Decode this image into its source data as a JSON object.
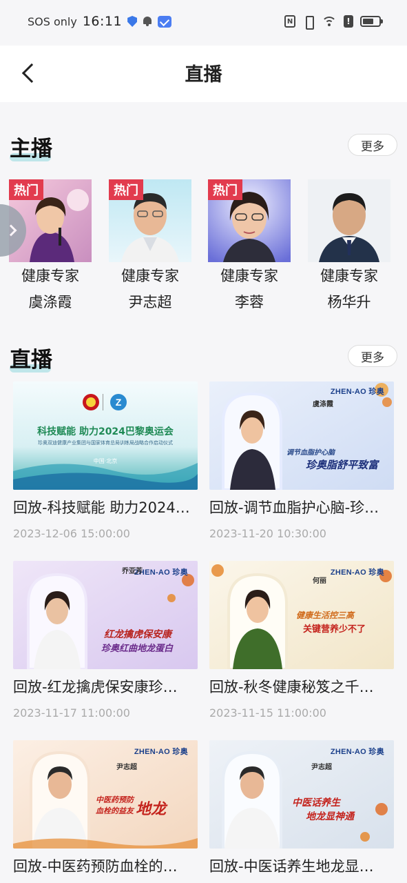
{
  "status_bar": {
    "carrier": "SOS only",
    "time": "16:11",
    "icons": [
      "shield-icon",
      "bell-icon",
      "mail-icon",
      "nfc-icon",
      "vibrate-icon",
      "wifi-icon",
      "alert-icon",
      "battery-icon"
    ]
  },
  "header": {
    "title": "直播",
    "back_icon": "chevron-left-icon"
  },
  "anchors_section": {
    "title": "主播",
    "more_label": "更多",
    "hot_label": "热门",
    "items": [
      {
        "role": "健康专家",
        "name": "虞涤霞",
        "hot": true
      },
      {
        "role": "健康专家",
        "name": "尹志超",
        "hot": true
      },
      {
        "role": "健康专家",
        "name": "李蓉",
        "hot": true
      },
      {
        "role": "健康专家",
        "name": "杨华升",
        "hot": false
      }
    ]
  },
  "live_section": {
    "title": "直播",
    "more_label": "更多",
    "items": [
      {
        "title": "回放-科技赋能 助力2024…",
        "time": "2023-12-06 15:00:00",
        "thumb": {
          "headline": "科技赋能 助力2024巴黎奥运会",
          "subline": "珍奥双迪健康产业集团与国家体育总局训练局战略合作启动仪式",
          "place": "中国·北京"
        }
      },
      {
        "title": "回放-调节血脂护心脑-珍…",
        "time": "2023-11-20 10:30:00",
        "thumb": {
          "brand": "ZHEN-AO 珍奥",
          "person": "虞涤霞",
          "line1": "调节血脂护心脑",
          "line2": "珍奥脂舒平致富"
        }
      },
      {
        "title": "回放-红龙擒虎保安康珍…",
        "time": "2023-11-17 11:00:00",
        "thumb": {
          "brand": "ZHEN-AO 珍奥",
          "person": "乔亚芳",
          "line1": "红龙擒虎保安康",
          "line2": "珍奥红曲地龙蛋白"
        }
      },
      {
        "title": "回放-秋冬健康秘笈之千…",
        "time": "2023-11-15 11:00:00",
        "thumb": {
          "brand": "ZHEN-AO 珍奥",
          "person": "何丽",
          "line1": "健康生活控三高",
          "line2": "关键营养少不了"
        }
      },
      {
        "title": "回放-中医药预防血栓的…",
        "time": "",
        "thumb": {
          "brand": "ZHEN-AO 珍奥",
          "person": "尹志超",
          "line1": "中医药预防",
          "line2": "血栓的益友",
          "line3": "地龙"
        }
      },
      {
        "title": "回放-中医话养生地龙显…",
        "time": "",
        "thumb": {
          "brand": "ZHEN-AO 珍奥",
          "person": "尹志超",
          "line1": "中医话养生",
          "line2": "地龙显神通"
        }
      }
    ]
  },
  "colors": {
    "accent_underline": "#bfe6ea",
    "hot_badge": "#e23b4e",
    "time_text": "#aaaaaa",
    "brand_blue": "#1a3f8a"
  }
}
